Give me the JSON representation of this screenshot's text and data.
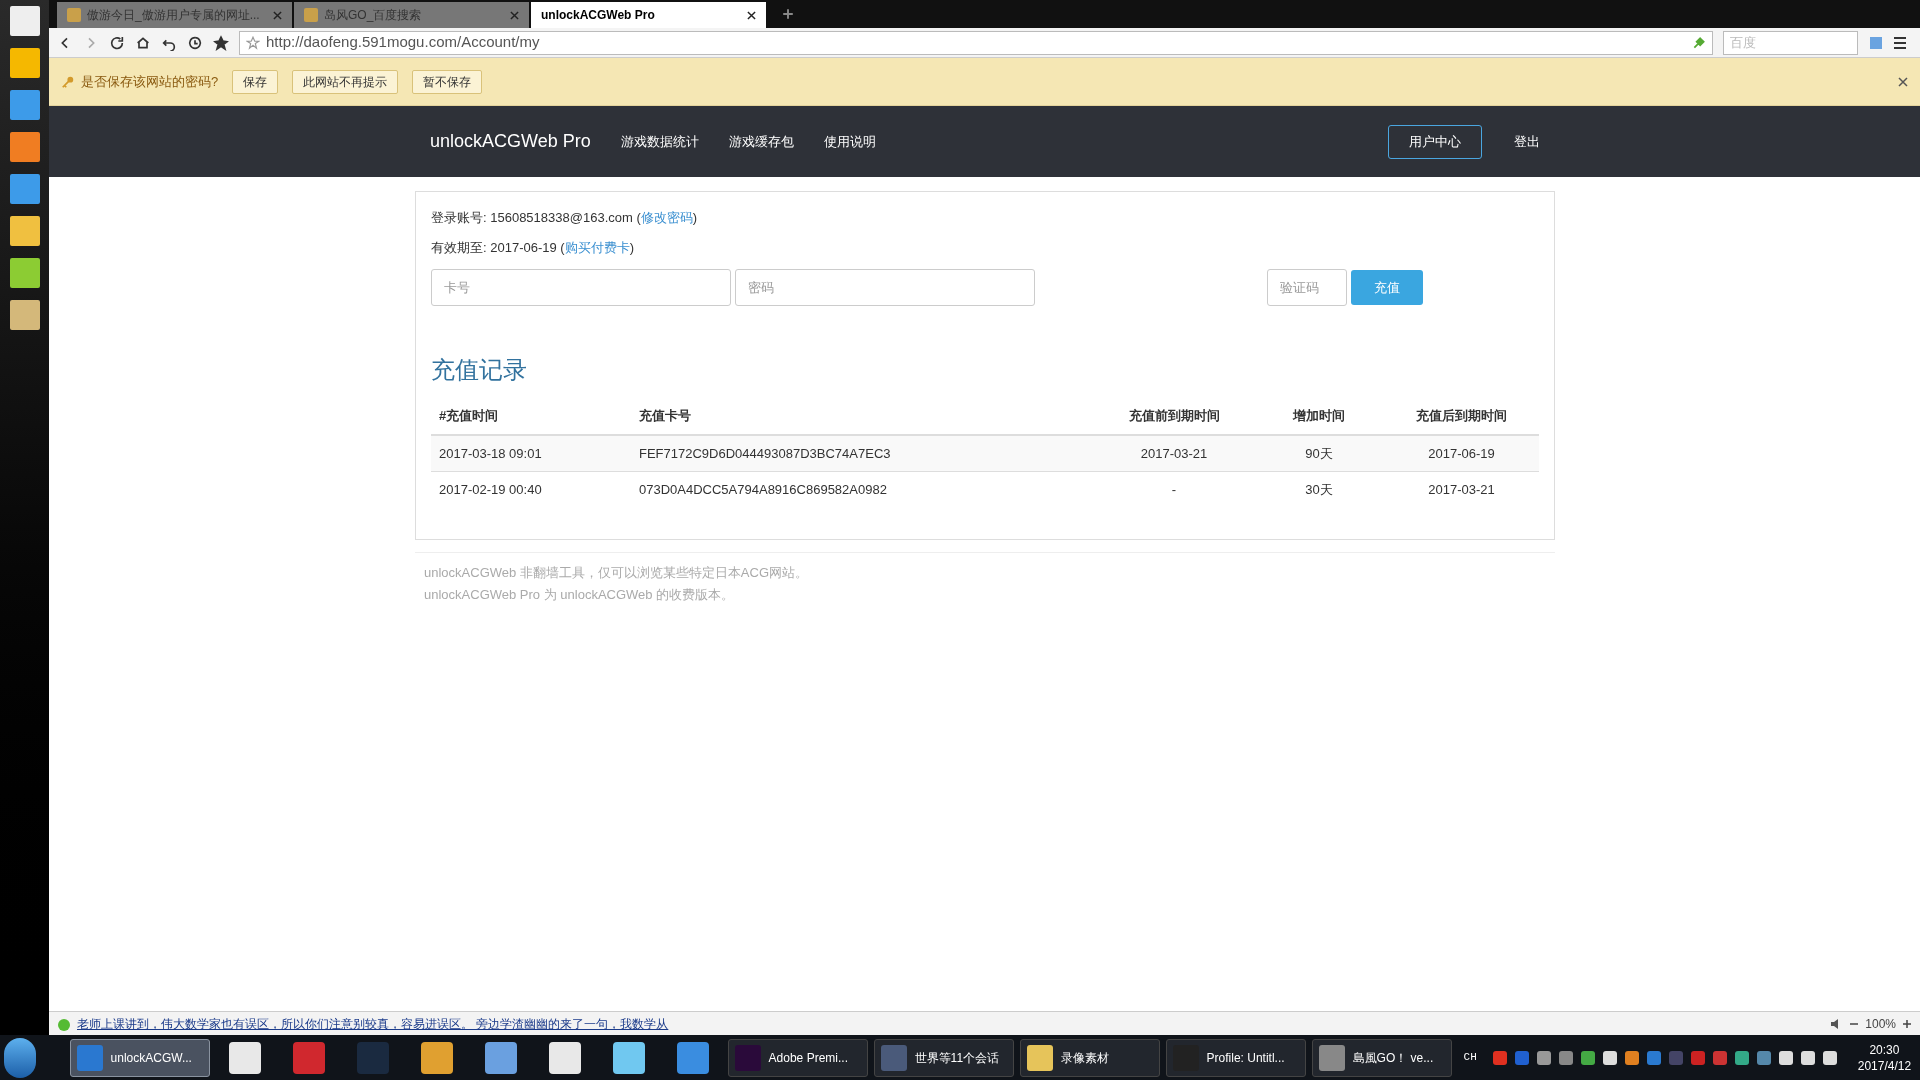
{
  "browser": {
    "tabs": [
      {
        "label": "傲游今日_傲游用户专属的网址...",
        "selected": false
      },
      {
        "label": "岛风GO_百度搜索",
        "selected": false
      },
      {
        "label": "unlockACGWeb Pro",
        "selected": true
      }
    ],
    "address": "http://daofeng.591mogu.com/Account/my",
    "search_placeholder": "百度",
    "password_bar": {
      "question": "是否保存该网站的密码?",
      "buttons": [
        "保存",
        "此网站不再提示",
        "暂不保存"
      ]
    }
  },
  "navbar": {
    "brand": "unlockACGWeb Pro",
    "links": [
      "游戏数据统计",
      "游戏缓存包",
      "使用说明"
    ],
    "user_center": "用户中心",
    "logout": "登出"
  },
  "account": {
    "login_label": "登录账号:",
    "login_value": "15608518338@163.com",
    "change_password": "修改密码",
    "expiry_label": "有效期至:",
    "expiry_value": "2017-06-19",
    "buy_card": "购买付费卡",
    "paren_open": "(",
    "paren_close": ")"
  },
  "recharge_form": {
    "card_placeholder": "卡号",
    "password_placeholder": "密码",
    "captcha_placeholder": "验证码",
    "submit": "充值"
  },
  "records": {
    "title": "充值记录",
    "columns": [
      "#充值时间",
      "充值卡号",
      "充值前到期时间",
      "增加时间",
      "充值后到期时间"
    ],
    "rows": [
      [
        "2017-03-18 09:01",
        "FEF7172C9D6D044493087D3BC74A7EC3",
        "2017-03-21",
        "90天",
        "2017-06-19"
      ],
      [
        "2017-02-19 00:40",
        "073D0A4DCC5A794A8916C869582A0982",
        "-",
        "30天",
        "2017-03-21"
      ]
    ]
  },
  "footer": [
    "unlockACGWeb 非翻墙工具，仅可以浏览某些特定日本ACG网站。",
    "unlockACGWeb Pro 为 unlockACGWeb 的收费版本。"
  ],
  "status_bar": {
    "message": "老师上课讲到，伟大数学家也有误区，所以你们注意别较真，容易进误区。 旁边学渣幽幽的来了一句，我数学从",
    "zoom": "100%"
  },
  "taskbar": {
    "items": [
      {
        "label": "unlockACGW...",
        "selected": true
      },
      {
        "label": "Adobe Premi...",
        "selected": false
      },
      {
        "label": "世界等11个会话",
        "selected": false
      },
      {
        "label": "录像素材",
        "selected": false
      },
      {
        "label": "Profile: Untitl...",
        "selected": false
      },
      {
        "label": "島風GO！ ve...",
        "selected": false
      }
    ],
    "input_language": "CH",
    "time": "20:30",
    "date": "2017/4/12"
  }
}
